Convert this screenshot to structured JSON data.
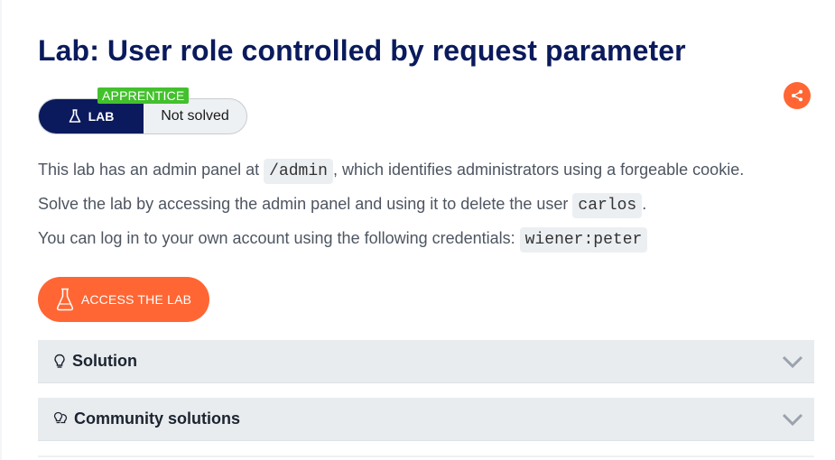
{
  "title": "Lab: User role controlled by request parameter",
  "badge": {
    "level": "APPRENTICE",
    "lab_label": "LAB",
    "status": "Not solved"
  },
  "description": {
    "p1_before": "This lab has an admin panel at ",
    "p1_code": "/admin",
    "p1_after": ", which identifies administrators using a forgeable cookie.",
    "p2_before": "Solve the lab by accessing the admin panel and using it to delete the user ",
    "p2_code": "carlos",
    "p2_after": ".",
    "p3_before": "You can log in to your own account using the following credentials: ",
    "p3_code": "wiener:peter"
  },
  "access_button": {
    "label": "ACCESS THE LAB",
    "icon": "flask-icon"
  },
  "share": {
    "icon": "share-icon"
  },
  "accordions": [
    {
      "label": "Solution",
      "icon": "lightbulb-icon"
    },
    {
      "label": "Community solutions",
      "icon": "two-lightbulbs-icon"
    }
  ],
  "colors": {
    "brand_navy": "#0a1a5c",
    "accent_orange": "#ff6633",
    "apprentice_green": "#43c12d",
    "accordion_bg": "#e8ecef"
  }
}
